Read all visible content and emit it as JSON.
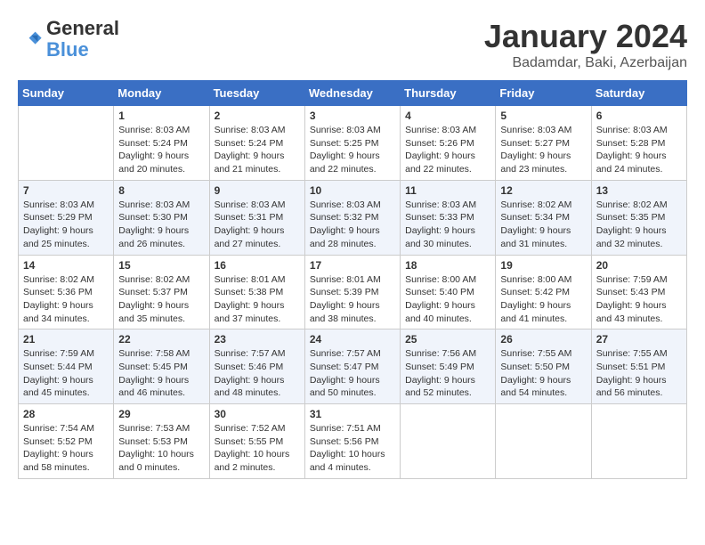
{
  "header": {
    "logo_line1": "General",
    "logo_line2": "Blue",
    "month": "January 2024",
    "location": "Badamdar, Baki, Azerbaijan"
  },
  "days_of_week": [
    "Sunday",
    "Monday",
    "Tuesday",
    "Wednesday",
    "Thursday",
    "Friday",
    "Saturday"
  ],
  "weeks": [
    [
      {
        "day": "",
        "info": ""
      },
      {
        "day": "1",
        "info": "Sunrise: 8:03 AM\nSunset: 5:24 PM\nDaylight: 9 hours\nand 20 minutes."
      },
      {
        "day": "2",
        "info": "Sunrise: 8:03 AM\nSunset: 5:24 PM\nDaylight: 9 hours\nand 21 minutes."
      },
      {
        "day": "3",
        "info": "Sunrise: 8:03 AM\nSunset: 5:25 PM\nDaylight: 9 hours\nand 22 minutes."
      },
      {
        "day": "4",
        "info": "Sunrise: 8:03 AM\nSunset: 5:26 PM\nDaylight: 9 hours\nand 22 minutes."
      },
      {
        "day": "5",
        "info": "Sunrise: 8:03 AM\nSunset: 5:27 PM\nDaylight: 9 hours\nand 23 minutes."
      },
      {
        "day": "6",
        "info": "Sunrise: 8:03 AM\nSunset: 5:28 PM\nDaylight: 9 hours\nand 24 minutes."
      }
    ],
    [
      {
        "day": "7",
        "info": "Sunrise: 8:03 AM\nSunset: 5:29 PM\nDaylight: 9 hours\nand 25 minutes."
      },
      {
        "day": "8",
        "info": "Sunrise: 8:03 AM\nSunset: 5:30 PM\nDaylight: 9 hours\nand 26 minutes."
      },
      {
        "day": "9",
        "info": "Sunrise: 8:03 AM\nSunset: 5:31 PM\nDaylight: 9 hours\nand 27 minutes."
      },
      {
        "day": "10",
        "info": "Sunrise: 8:03 AM\nSunset: 5:32 PM\nDaylight: 9 hours\nand 28 minutes."
      },
      {
        "day": "11",
        "info": "Sunrise: 8:03 AM\nSunset: 5:33 PM\nDaylight: 9 hours\nand 30 minutes."
      },
      {
        "day": "12",
        "info": "Sunrise: 8:02 AM\nSunset: 5:34 PM\nDaylight: 9 hours\nand 31 minutes."
      },
      {
        "day": "13",
        "info": "Sunrise: 8:02 AM\nSunset: 5:35 PM\nDaylight: 9 hours\nand 32 minutes."
      }
    ],
    [
      {
        "day": "14",
        "info": "Sunrise: 8:02 AM\nSunset: 5:36 PM\nDaylight: 9 hours\nand 34 minutes."
      },
      {
        "day": "15",
        "info": "Sunrise: 8:02 AM\nSunset: 5:37 PM\nDaylight: 9 hours\nand 35 minutes."
      },
      {
        "day": "16",
        "info": "Sunrise: 8:01 AM\nSunset: 5:38 PM\nDaylight: 9 hours\nand 37 minutes."
      },
      {
        "day": "17",
        "info": "Sunrise: 8:01 AM\nSunset: 5:39 PM\nDaylight: 9 hours\nand 38 minutes."
      },
      {
        "day": "18",
        "info": "Sunrise: 8:00 AM\nSunset: 5:40 PM\nDaylight: 9 hours\nand 40 minutes."
      },
      {
        "day": "19",
        "info": "Sunrise: 8:00 AM\nSunset: 5:42 PM\nDaylight: 9 hours\nand 41 minutes."
      },
      {
        "day": "20",
        "info": "Sunrise: 7:59 AM\nSunset: 5:43 PM\nDaylight: 9 hours\nand 43 minutes."
      }
    ],
    [
      {
        "day": "21",
        "info": "Sunrise: 7:59 AM\nSunset: 5:44 PM\nDaylight: 9 hours\nand 45 minutes."
      },
      {
        "day": "22",
        "info": "Sunrise: 7:58 AM\nSunset: 5:45 PM\nDaylight: 9 hours\nand 46 minutes."
      },
      {
        "day": "23",
        "info": "Sunrise: 7:57 AM\nSunset: 5:46 PM\nDaylight: 9 hours\nand 48 minutes."
      },
      {
        "day": "24",
        "info": "Sunrise: 7:57 AM\nSunset: 5:47 PM\nDaylight: 9 hours\nand 50 minutes."
      },
      {
        "day": "25",
        "info": "Sunrise: 7:56 AM\nSunset: 5:49 PM\nDaylight: 9 hours\nand 52 minutes."
      },
      {
        "day": "26",
        "info": "Sunrise: 7:55 AM\nSunset: 5:50 PM\nDaylight: 9 hours\nand 54 minutes."
      },
      {
        "day": "27",
        "info": "Sunrise: 7:55 AM\nSunset: 5:51 PM\nDaylight: 9 hours\nand 56 minutes."
      }
    ],
    [
      {
        "day": "28",
        "info": "Sunrise: 7:54 AM\nSunset: 5:52 PM\nDaylight: 9 hours\nand 58 minutes."
      },
      {
        "day": "29",
        "info": "Sunrise: 7:53 AM\nSunset: 5:53 PM\nDaylight: 10 hours\nand 0 minutes."
      },
      {
        "day": "30",
        "info": "Sunrise: 7:52 AM\nSunset: 5:55 PM\nDaylight: 10 hours\nand 2 minutes."
      },
      {
        "day": "31",
        "info": "Sunrise: 7:51 AM\nSunset: 5:56 PM\nDaylight: 10 hours\nand 4 minutes."
      },
      {
        "day": "",
        "info": ""
      },
      {
        "day": "",
        "info": ""
      },
      {
        "day": "",
        "info": ""
      }
    ]
  ]
}
